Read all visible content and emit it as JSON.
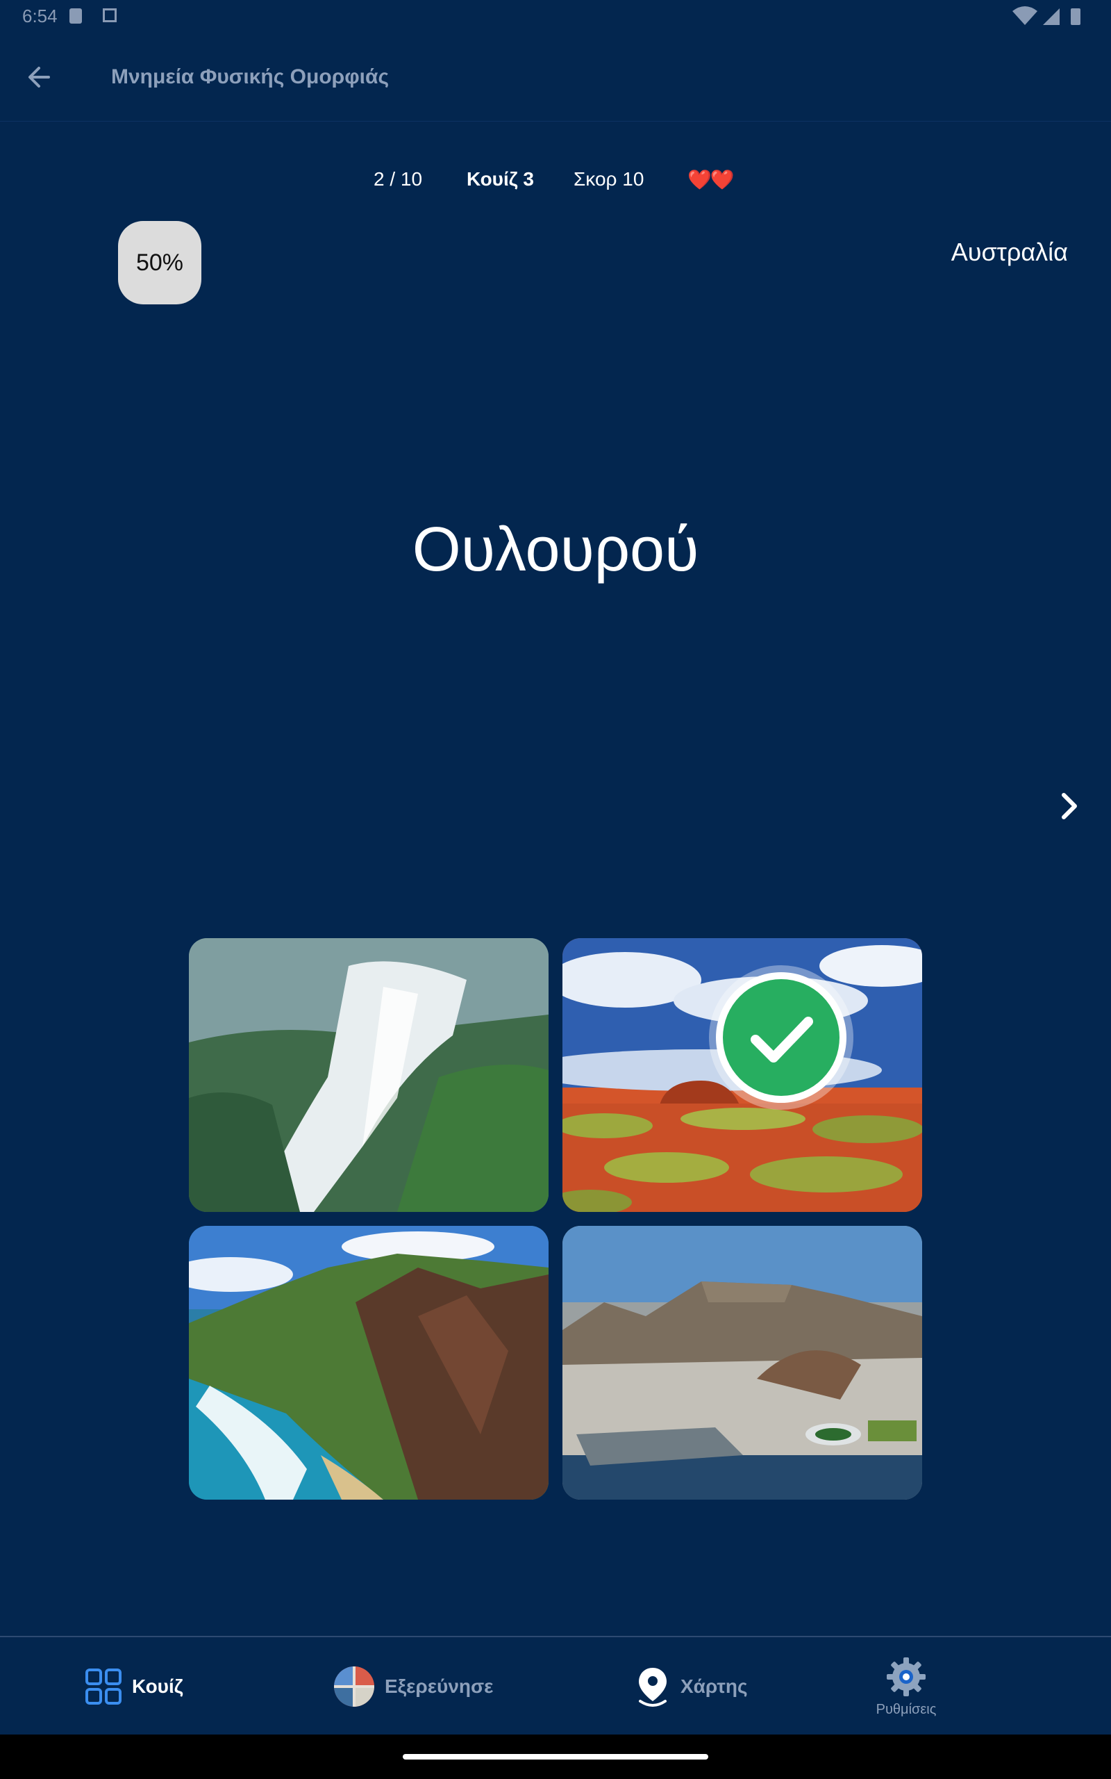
{
  "status_bar": {
    "time": "6:54"
  },
  "app_bar": {
    "title": "Μνημεία Φυσικής Ομορφιάς",
    "back_icon": "arrow-back-icon"
  },
  "stats": {
    "progress": "2 / 10",
    "quiz": "Κουίζ 3",
    "score": "Σκορ 10",
    "hearts": "❤️❤️"
  },
  "helper": {
    "fifty_label": "50%"
  },
  "country": "Αυστραλία",
  "question": "Ουλουρού",
  "next_icon": "chevron-right-icon",
  "answers": [
    {
      "subject": "waterfall-canyon",
      "correct": false
    },
    {
      "subject": "red-rock-desert",
      "correct": true
    },
    {
      "subject": "green-cliffs-coast",
      "correct": false
    },
    {
      "subject": "city-mountain-harbor",
      "correct": false
    }
  ],
  "colors": {
    "background": "#03264f",
    "correct": "#27ae60",
    "accent": "#3b8ef0"
  },
  "bottom_nav": {
    "items": [
      {
        "label": "Κουίζ",
        "icon": "grid-icon",
        "active": true
      },
      {
        "label": "Εξερεύνησε",
        "icon": "globe-icon",
        "active": false
      },
      {
        "label": "Χάρτης",
        "icon": "map-pin-icon",
        "active": false
      },
      {
        "label": "Ρυθμίσεις",
        "icon": "gear-icon",
        "active": false
      }
    ]
  }
}
